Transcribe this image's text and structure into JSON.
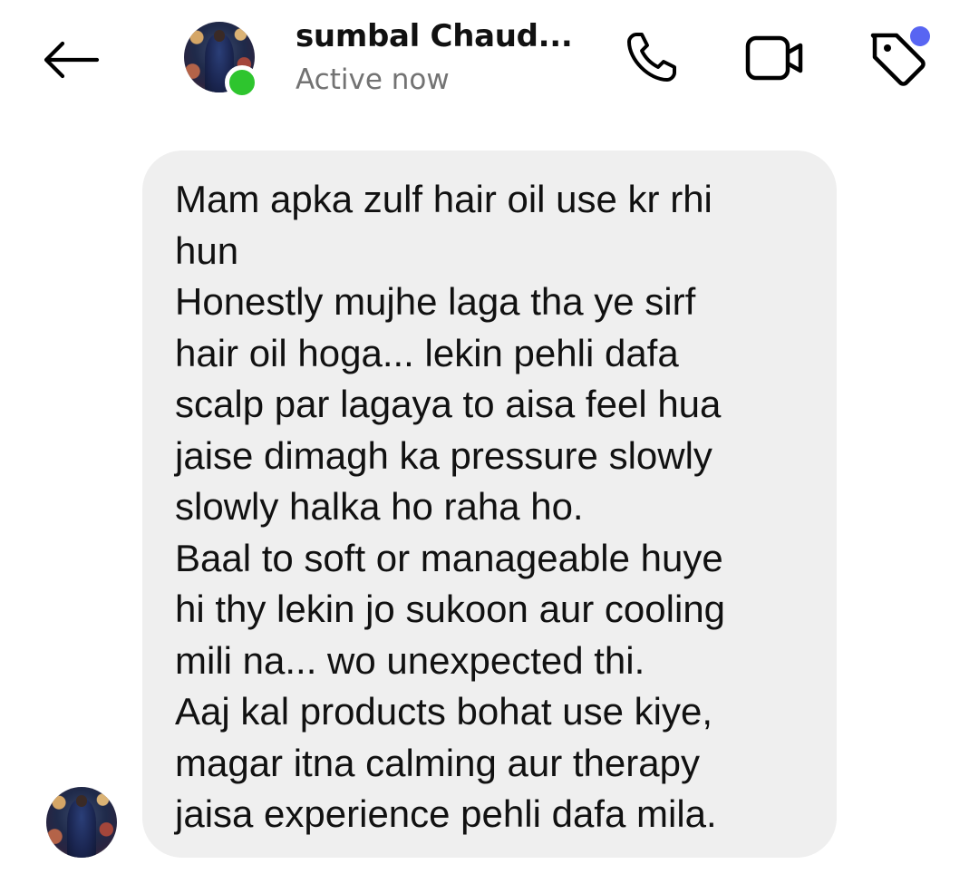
{
  "header": {
    "back_icon": "arrow-left-icon",
    "contact_name": "sumbal Chaud...",
    "status": "Active now",
    "actions": [
      {
        "icon": "phone-icon"
      },
      {
        "icon": "video-camera-icon"
      },
      {
        "icon": "tag-icon",
        "has_notification_dot": true,
        "notification_dot_color": "#5865f2"
      }
    ],
    "online_indicator_color": "#2ec52e"
  },
  "conversation": {
    "messages": [
      {
        "direction": "incoming",
        "bubble_color": "#efefef",
        "text": "Mam apka zulf hair oil use kr rhi\nhun\nHonestly mujhe laga tha ye sirf\nhair oil hoga... lekin pehli dafa\nscalp par lagaya to aisa feel hua\njaise dimagh ka pressure slowly\nslowly halka ho raha ho.\nBaal to soft or manageable huye\nhi thy lekin jo sukoon aur cooling\nmili na... wo unexpected thi.\nAaj kal products bohat use kiye,\nmagar itna calming aur therapy\njaisa experience pehli dafa mila."
      }
    ]
  }
}
